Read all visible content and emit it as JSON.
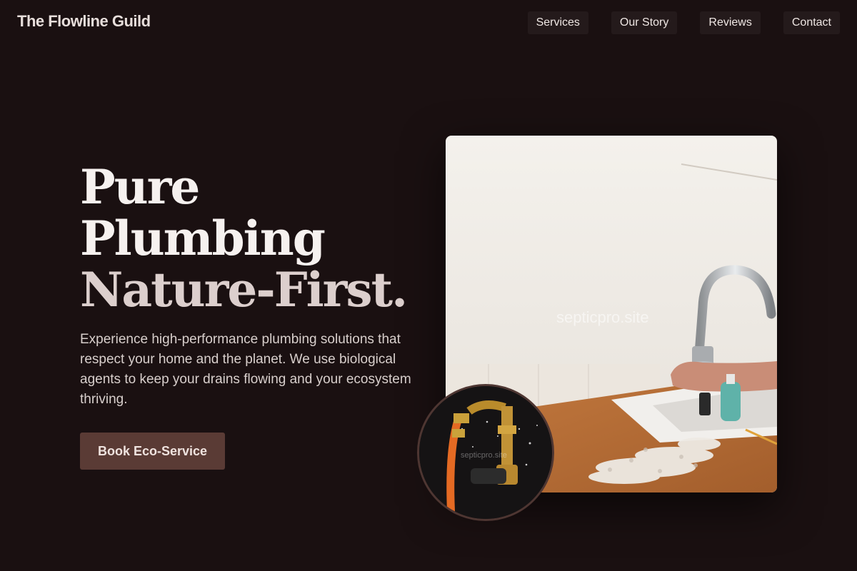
{
  "header": {
    "brand": "The Flowline Guild",
    "nav": [
      "Services",
      "Our Story",
      "Reviews",
      "Contact"
    ]
  },
  "hero": {
    "headline": [
      "Pure",
      "Plumbing",
      "Nature-First."
    ],
    "description": "Experience high-performance plumbing solutions that respect your home and the planet. We use biological agents to keep your drains flowing and your ecosystem thriving.",
    "cta_label": "Book Eco-Service"
  },
  "images": {
    "main_watermark": "septicpro.site",
    "circle_watermark": "septicpro.site"
  },
  "colors": {
    "background": "#1a1011",
    "cta": "#5a3b35",
    "nav_bg": "#241a1b"
  }
}
